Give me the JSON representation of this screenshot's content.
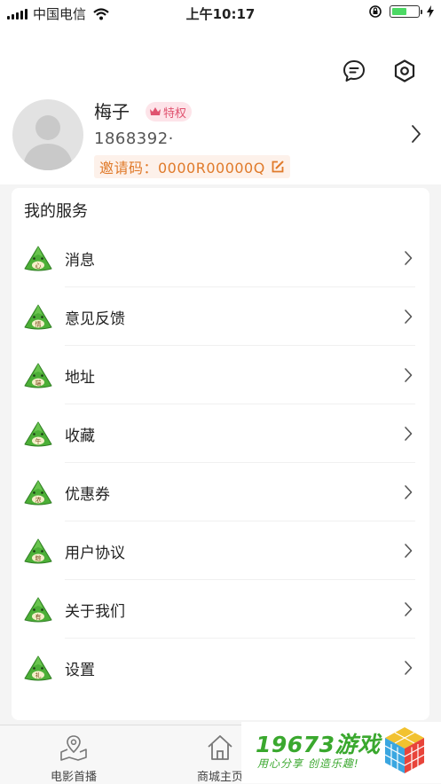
{
  "status_bar": {
    "carrier": "中国电信",
    "time": "上午10:17",
    "battery_level": 0.6
  },
  "header": {
    "user_name": "梅子",
    "badge_label": "特权",
    "phone": "1868392·",
    "invite_label": "邀请码：0000R00000Q",
    "icons": [
      "message-icon",
      "settings-icon",
      "edit-icon",
      "chevron-right-icon"
    ]
  },
  "services": {
    "title": "我的服务",
    "items": [
      {
        "label": "消息",
        "glyph": "心"
      },
      {
        "label": "意见反馈",
        "glyph": "情"
      },
      {
        "label": "地址",
        "glyph": "端"
      },
      {
        "label": "收藏",
        "glyph": "午"
      },
      {
        "label": "优惠券",
        "glyph": "浓"
      },
      {
        "label": "用户协议",
        "glyph": "粽"
      },
      {
        "label": "关于我们",
        "glyph": "有"
      },
      {
        "label": "设置",
        "glyph": "礼"
      }
    ]
  },
  "tabbar": {
    "tabs": [
      {
        "label": "电影首播"
      },
      {
        "label": "商城主页"
      }
    ]
  },
  "watermark": {
    "title": "19673游戏",
    "subtitle": "用心分享 创造乐趣!"
  },
  "colors": {
    "accent_orange": "#e07a2a",
    "badge_pink": "#e0526f",
    "zongzi_green": "#4caf37"
  }
}
